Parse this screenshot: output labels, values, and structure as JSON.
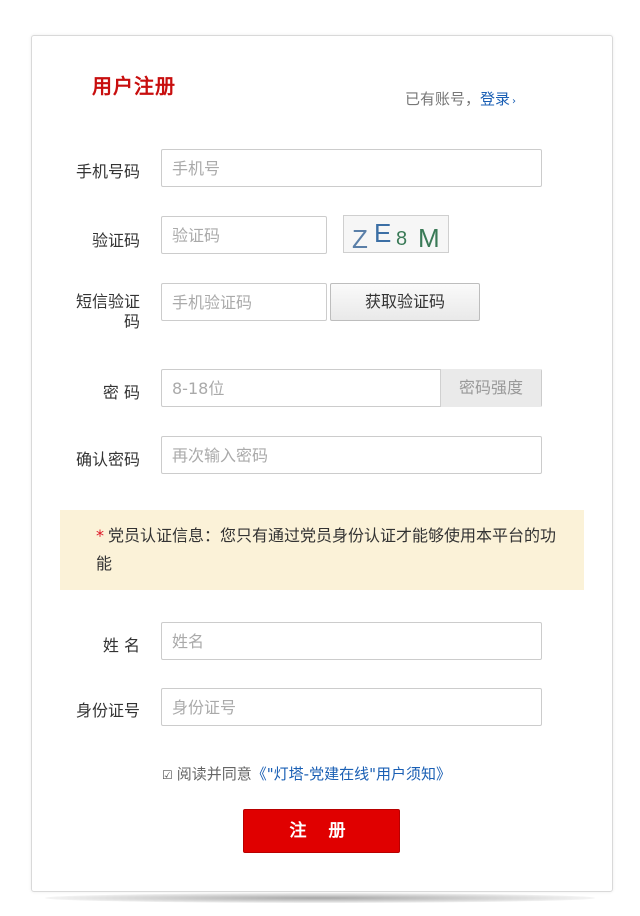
{
  "header": {
    "title": "用户注册",
    "login_prompt": "已有账号，",
    "login_link": "登录",
    "login_arrow": "›"
  },
  "form": {
    "phone": {
      "label": "手机号码",
      "placeholder": "手机号"
    },
    "captcha": {
      "label": "验证码",
      "placeholder": "验证码",
      "image_text": "ZE8M"
    },
    "sms": {
      "label": "短信验证码",
      "placeholder": "手机验证码",
      "button": "获取验证码"
    },
    "password": {
      "label": "密 码",
      "placeholder": "8-18位",
      "strength": "密码强度"
    },
    "confirm": {
      "label": "确认密码",
      "placeholder": "再次输入密码"
    },
    "notice": {
      "star": "*",
      "text": "党员认证信息：您只有通过党员身份认证才能够使用本平台的功能"
    },
    "name": {
      "label": "姓 名",
      "placeholder": "姓名"
    },
    "id_number": {
      "label": "身份证号",
      "placeholder": "身份证号"
    },
    "agree": {
      "text": "阅读并同意",
      "link": "《\"灯塔-党建在线\"用户须知》",
      "checked": true
    },
    "submit": "注 册"
  },
  "colors": {
    "title": "#c80e0e",
    "link": "#1a5fb4",
    "submit": "#e00000",
    "notice_bg": "#fbf2d8"
  }
}
